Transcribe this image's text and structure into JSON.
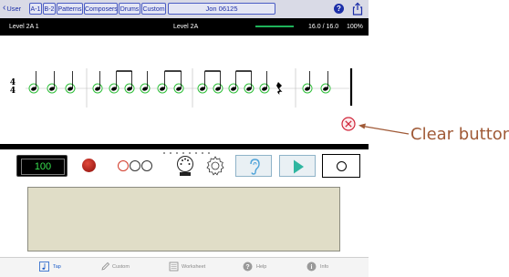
{
  "nav": {
    "back_label": "User",
    "buttons": [
      "A-1",
      "B-2",
      "Patterns",
      "Composers",
      "Drums",
      "Custom"
    ],
    "title_field": "Jon 06125"
  },
  "level_bar": {
    "left_label": "Level 2A 1",
    "center_label": "Level 2A",
    "score": "16.0 / 16.0",
    "percent": "100%",
    "progress": 1.0
  },
  "notation": {
    "time_signature": [
      "4",
      "4"
    ]
  },
  "controls": {
    "tempo": "100"
  },
  "tabs": [
    {
      "label": "Tap",
      "icon": "music-note-icon",
      "active": true
    },
    {
      "label": "Custom",
      "icon": "pencil-icon",
      "active": false
    },
    {
      "label": "Worksheet",
      "icon": "worksheet-icon",
      "active": false
    },
    {
      "label": "Help",
      "icon": "help-icon",
      "active": false
    },
    {
      "label": "Info",
      "icon": "info-icon",
      "active": false
    }
  ],
  "annotation": {
    "label": "Clear button"
  },
  "colors": {
    "accent": "#1d2fa8",
    "note_ring": "#2fbf3a",
    "clear_button": "#d0263a",
    "tempo_text": "#38e04f",
    "annotation": "#a05a37"
  }
}
